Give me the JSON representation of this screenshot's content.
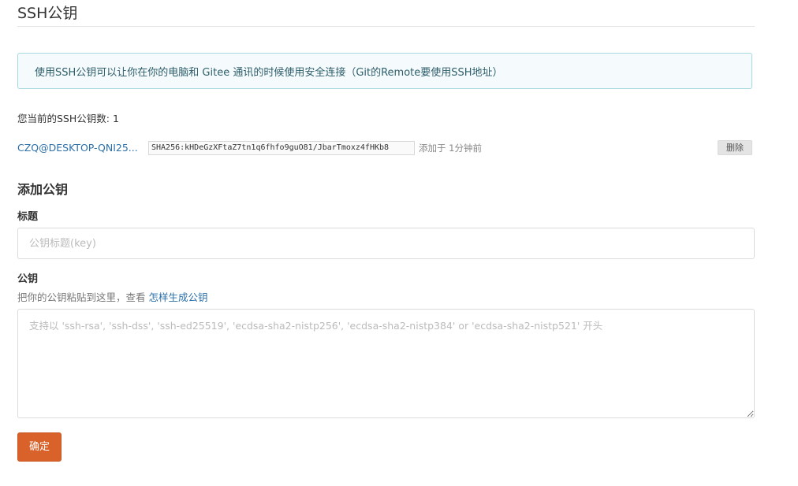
{
  "header": {
    "title": "SSH公钥"
  },
  "info": {
    "text": "使用SSH公钥可以让你在你的电脑和 Gitee 通讯的时候使用安全连接（Git的Remote要使用SSH地址）"
  },
  "keys": {
    "count_text": "您当前的SSH公钥数: 1",
    "items": [
      {
        "name": "CZQ@DESKTOP-QNI25...",
        "fingerprint": "SHA256:kHDeGzXFtaZ7tn1q6fhfo9guO81/JbarTmoxz4fHKb8",
        "added": "添加于 1分钟前",
        "delete_label": "删除"
      }
    ]
  },
  "add_form": {
    "heading": "添加公钥",
    "title_label": "标题",
    "title_placeholder": "公钥标题(key)",
    "title_value": "",
    "key_label": "公钥",
    "key_hint_prefix": "把你的公钥粘贴到这里，查看 ",
    "key_hint_link": "怎样生成公钥",
    "key_placeholder": "支持以 'ssh-rsa', 'ssh-dss', 'ssh-ed25519', 'ecdsa-sha2-nistp256', 'ecdsa-sha2-nistp384' or 'ecdsa-sha2-nistp521' 开头",
    "key_value": "",
    "submit_label": "确定"
  },
  "colors": {
    "accent": "#d9622b",
    "link": "#2a6fa8",
    "info_bg": "#f5fbfc",
    "info_border": "#a8d8df"
  }
}
